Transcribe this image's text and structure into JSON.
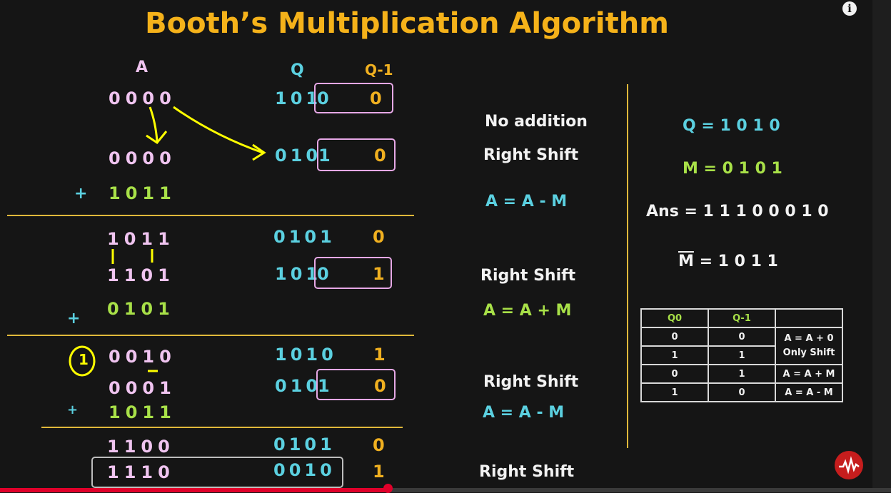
{
  "title": "Booth’s Multiplication Algorithm",
  "headers": {
    "a": "A",
    "q": "Q",
    "qm1": "Q-1"
  },
  "rows": {
    "r1_a": "0000",
    "r1_q_main": "101",
    "r1_q_last": "0",
    "r1_qm1": "0",
    "r2_a": "0000",
    "r2_q_main": "010",
    "r2_q_last": "1",
    "r2_qm1": "0",
    "r3_op": "+",
    "r3_m": "1011",
    "r4_a": "1011",
    "r4_q": "0101",
    "r4_qm1": "0",
    "r5_a": "1101",
    "r5_q_main": "101",
    "r5_q_last": "0",
    "r5_qm1": "1",
    "r6_op": "+",
    "r6_m": "0101",
    "r7_carry": "1",
    "r7_a": "0010",
    "r7_q": "1010",
    "r7_qm1": "1",
    "r8_a": "0001",
    "r8_q_main": "010",
    "r8_q_last": "1",
    "r8_qm1": "0",
    "r9_op": "+",
    "r9_m": "1011",
    "r10_a": "1100",
    "r10_q": "0101",
    "r10_qm1": "0",
    "r11_a": "1110",
    "r11_q": "0010",
    "r11_qm1": "1"
  },
  "steps": {
    "s1": "No addition",
    "s2": "Right Shift",
    "s3": "A = A - M",
    "s4": "Right Shift",
    "s5": "A = A + M",
    "s6": "Right Shift",
    "s7": "A = A - M",
    "s8": "Right Shift"
  },
  "given": {
    "q": "Q = 1 0 1 0",
    "m": "M = 0 1 0 1",
    "ans": "Ans = 1 1 1 0 0 0 1 0",
    "mbar_letter": "M",
    "mbar_rest": " = 1 0 1 1"
  },
  "table": {
    "header": [
      "Q0",
      "Q-1",
      ""
    ],
    "rows": [
      [
        "0",
        "0"
      ],
      [
        "1",
        "1"
      ],
      [
        "0",
        "1",
        "A = A + M"
      ],
      [
        "1",
        "0",
        "A = A - M"
      ]
    ],
    "merged_op": [
      "A = A + 0",
      "Only Shift"
    ]
  },
  "player": {
    "info_icon": "i",
    "progress_fraction": 0.435
  },
  "colors": {
    "title": "#f5b21a",
    "register_a": "#f0c4f0",
    "register_q": "#5bd0e0",
    "q_minus_1": "#f0b020",
    "multiplicand": "#a8e048",
    "annotation": "#ffff00",
    "divider": "#e0b83a",
    "progress": "#e0002a"
  }
}
